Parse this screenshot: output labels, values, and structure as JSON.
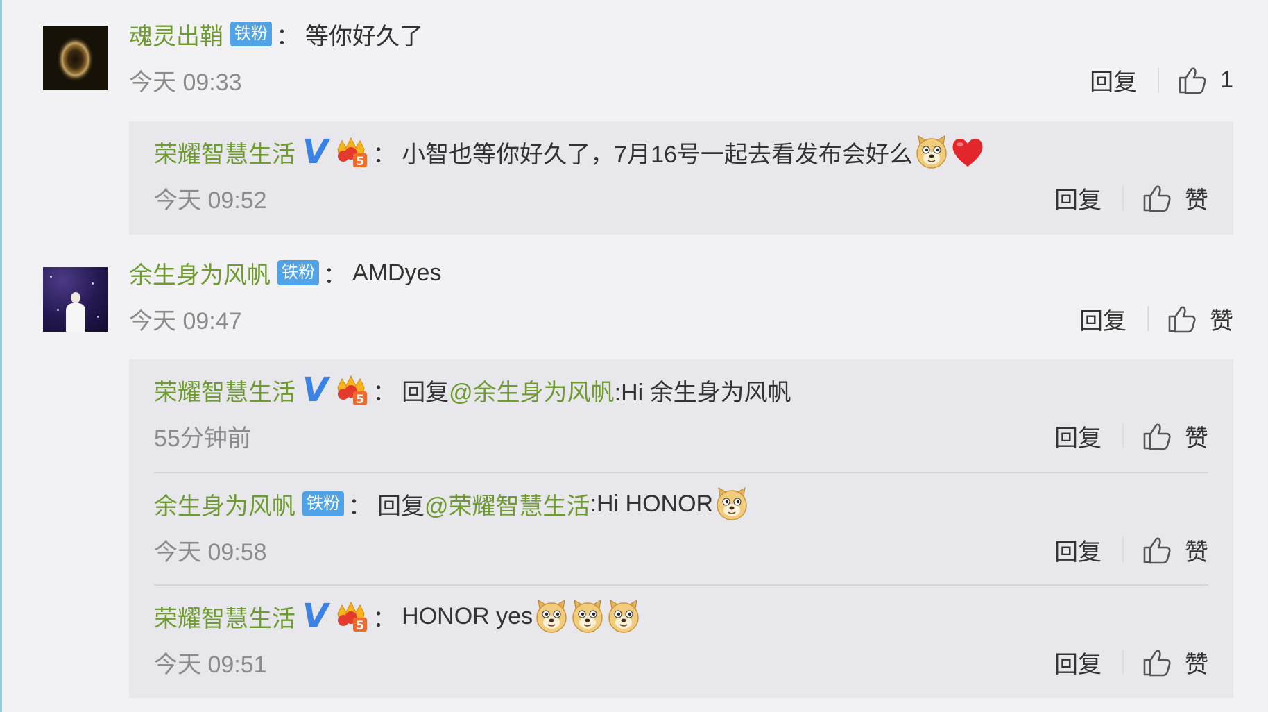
{
  "comments": [
    {
      "user": "魂灵出鞘",
      "badge": "铁粉",
      "colon": "：",
      "text": "等你好久了",
      "time": "今天 09:33",
      "reply_label": "回复",
      "like_label": "1",
      "avatar": "tunnel-photo",
      "replies": [
        {
          "user": "荣耀智慧生活",
          "verified": "V",
          "colon": "：",
          "text": "小智也等你好久了，7月16号一起去看发布会好么",
          "emojis": [
            "doge-emoji",
            "red-heart-emoji"
          ],
          "time": "今天 09:52",
          "reply_label": "回复",
          "like_label": "赞"
        }
      ]
    },
    {
      "user": "余生身为风帆",
      "badge": "铁粉",
      "colon": "：",
      "text": "AMDyes",
      "time": "今天 09:47",
      "reply_label": "回复",
      "like_label": "赞",
      "avatar": "night-figure-photo",
      "replies": [
        {
          "user": "荣耀智慧生活",
          "verified": "V",
          "colon": "：",
          "prefix": "回复",
          "mention": "@余生身为风帆",
          "text": ":Hi 余生身为风帆",
          "time": "55分钟前",
          "reply_label": "回复",
          "like_label": "赞"
        },
        {
          "user": "余生身为风帆",
          "badge": "铁粉",
          "colon": "：",
          "prefix": "回复",
          "mention": "@荣耀智慧生活",
          "text": ":Hi HONOR",
          "emojis": [
            "doge-emoji"
          ],
          "time": "今天 09:58",
          "reply_label": "回复",
          "like_label": "赞"
        },
        {
          "user": "荣耀智慧生活",
          "verified": "V",
          "colon": "：",
          "text": "HONOR yes",
          "emojis": [
            "doge-emoji",
            "doge-emoji",
            "doge-emoji"
          ],
          "time": "今天 09:51",
          "reply_label": "回复",
          "like_label": "赞"
        }
      ]
    }
  ],
  "colors": {
    "username": "#6f9b32",
    "fan_badge": "#4fa3e6",
    "verified": "#3b82e6",
    "time": "#8c8c8c",
    "page_bg": "#f2f2f5",
    "reply_bg": "#e8e8ec"
  }
}
